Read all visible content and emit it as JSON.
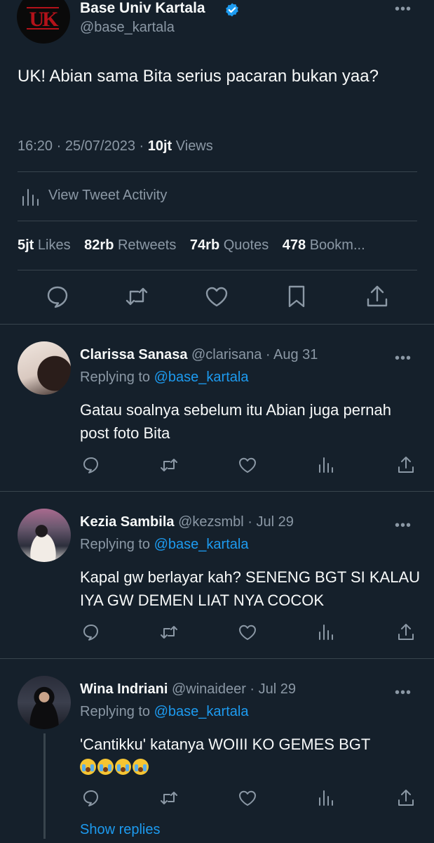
{
  "main_tweet": {
    "avatar_logo_text": "UK",
    "name": "Base Univ Kartala",
    "handle": "@base_kartala",
    "text": "UK! Abian sama Bita serius pacaran bukan yaa?",
    "time": "16:20",
    "date": "25/07/2023",
    "views_count": "10jt",
    "views_label": "Views",
    "activity_label": "View Tweet Activity",
    "stats": {
      "likes_count": "5jt",
      "likes_label": "Likes",
      "retweets_count": "82rb",
      "retweets_label": "Retweets",
      "quotes_count": "74rb",
      "quotes_label": "Quotes",
      "bookmarks_count": "478",
      "bookmarks_label": "Bookm..."
    }
  },
  "replies": [
    {
      "name": "Clarissa Sanasa",
      "handle": "@clarisana",
      "date": "Aug 31",
      "replying_prefix": "Replying to",
      "replying_to": "@base_kartala",
      "text": "Gatau soalnya sebelum itu Abian juga pernah post foto Bita"
    },
    {
      "name": "Kezia Sambila",
      "handle": "@kezsmbl",
      "date": "Jul 29",
      "replying_prefix": "Replying to",
      "replying_to": "@base_kartala",
      "text": "Kapal gw berlayar kah? SENENG BGT SI KALAU IYA GW DEMEN LIAT NYA COCOK"
    },
    {
      "name": "Wina Indriani",
      "handle": "@winaideer",
      "date": "Jul 29",
      "replying_prefix": "Replying to",
      "replying_to": "@base_kartala",
      "text": "'Cantikku' katanya WOIII KO GEMES BGT",
      "emoji_count": 4,
      "show_replies_label": "Show replies"
    }
  ],
  "separator": " · ",
  "colors": {
    "background": "#15202b",
    "text_primary": "#f7f9f9",
    "text_secondary": "#8b98a5",
    "link": "#1d9bf0",
    "divider": "#38444d",
    "logo_red": "#b3121a"
  },
  "icons": {
    "verified": "verified-badge-icon",
    "more": "more-dots-icon",
    "reply": "reply-bubble-icon",
    "retweet": "retweet-icon",
    "like": "heart-icon",
    "bookmark": "bookmark-icon",
    "share": "share-icon",
    "analytics": "analytics-bars-icon"
  }
}
